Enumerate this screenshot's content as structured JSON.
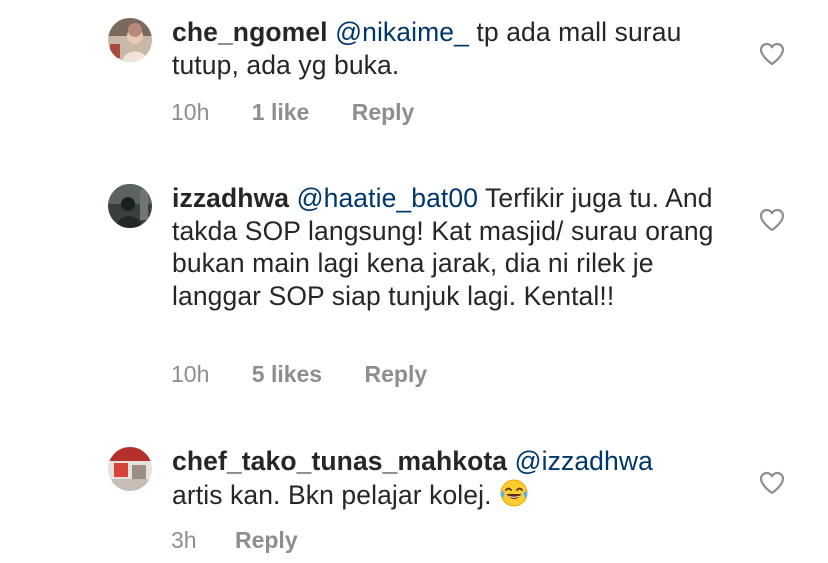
{
  "comments": [
    {
      "username": "che_ngomel",
      "mention": "@nikaime_",
      "text": " tp ada mall surau tutup, ada yg buka.",
      "time": "10h",
      "likes": "1 like",
      "reply": "Reply",
      "avatar_icon": "user-avatar-icon"
    },
    {
      "username": "izzadhwa",
      "mention": "@haatie_bat00",
      "text": " Terfikir juga tu. And takda SOP langsung! Kat masjid/ surau orang bukan main lagi kena jarak, dia ni rilek je langgar SOP siap tunjuk lagi. Kental!!",
      "time": "10h",
      "likes": "5 likes",
      "reply": "Reply",
      "avatar_icon": "user-avatar-icon"
    },
    {
      "username": "chef_tako_tunas_mahkota",
      "mention": "@izzadhwa",
      "text_line1": "",
      "text_line2": "artis kan. Bkn pelajar kolej. ",
      "emoji_icon": "tears-of-joy-emoji-icon",
      "time": "3h",
      "reply": "Reply",
      "avatar_icon": "user-avatar-icon"
    }
  ],
  "colors": {
    "text": "#262626",
    "mention": "#00376b",
    "meta": "#8e8e8e",
    "heart": "#8e8e8e"
  },
  "icons": {
    "like": "heart-outline-icon"
  }
}
